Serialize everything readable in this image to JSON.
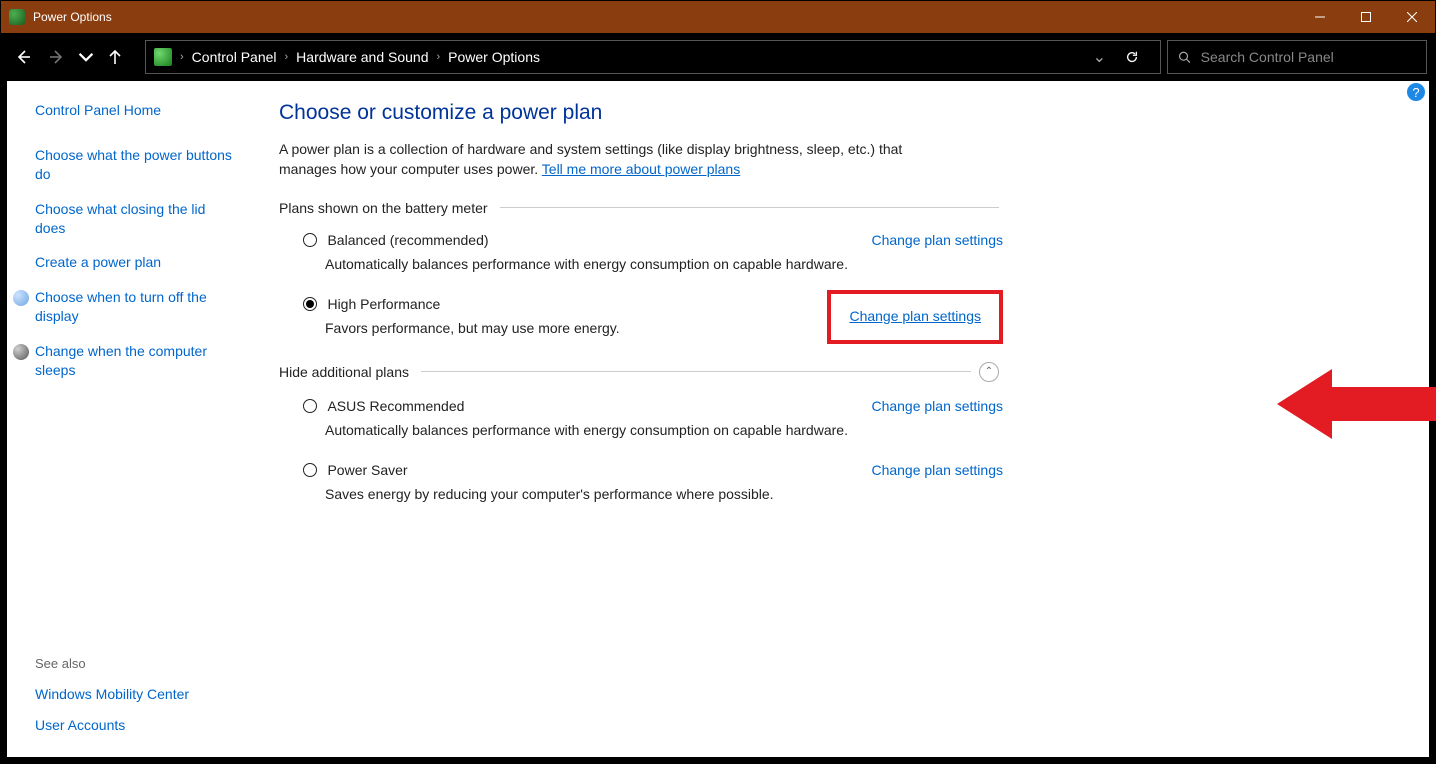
{
  "window": {
    "title": "Power Options"
  },
  "breadcrumb": {
    "root": "Control Panel",
    "mid": "Hardware and Sound",
    "leaf": "Power Options"
  },
  "search": {
    "placeholder": "Search Control Panel"
  },
  "sidebar": {
    "home": "Control Panel Home",
    "links": {
      "buttons": "Choose what the power buttons do",
      "lid": "Choose what closing the lid does",
      "create": "Create a power plan",
      "display": "Choose when to turn off the display",
      "sleep": "Change when the computer sleeps"
    },
    "see_also_label": "See also",
    "see_also": {
      "mobility": "Windows Mobility Center",
      "accounts": "User Accounts"
    }
  },
  "main": {
    "heading": "Choose or customize a power plan",
    "intro_part1": "A power plan is a collection of hardware and system settings (like display brightness, sleep, etc.) that manages how your computer uses power. ",
    "intro_link": "Tell me more about power plans",
    "section1": "Plans shown on the battery meter",
    "section2": "Hide additional plans",
    "change_link": "Change plan settings",
    "plans": {
      "balanced": {
        "name": "Balanced (recommended)",
        "desc": "Automatically balances performance with energy consumption on capable hardware."
      },
      "highperf": {
        "name": "High Performance",
        "desc": "Favors performance, but may use more energy."
      },
      "asus": {
        "name": "ASUS Recommended",
        "desc": "Automatically balances performance with energy consumption on capable hardware."
      },
      "saver": {
        "name": "Power Saver",
        "desc": "Saves energy by reducing your computer's performance where possible."
      }
    }
  }
}
